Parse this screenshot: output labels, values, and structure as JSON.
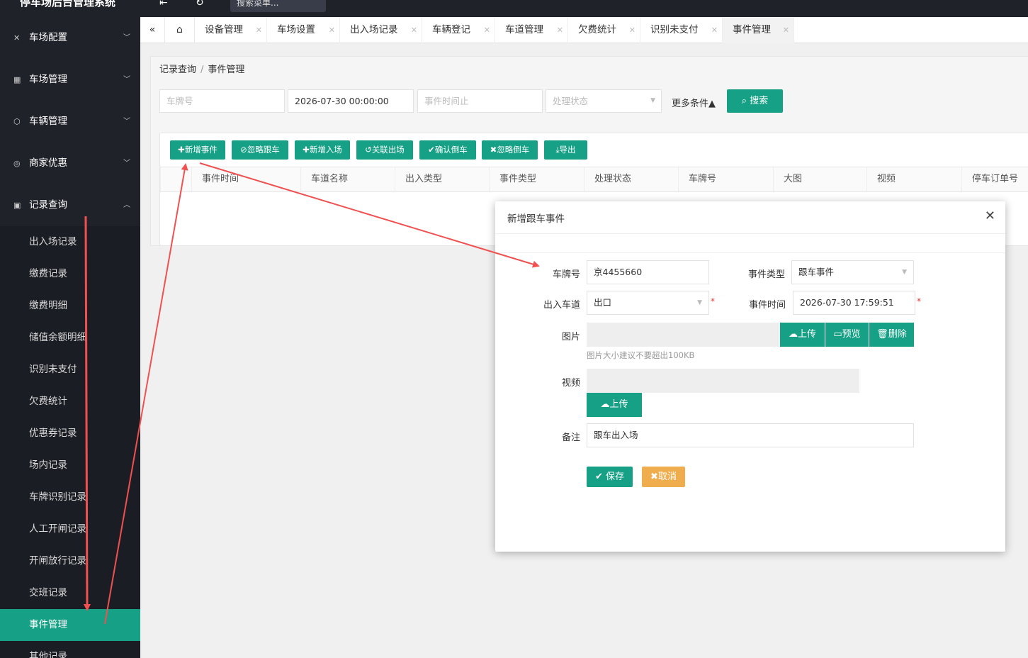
{
  "app": {
    "title": "停车场后台管理系统",
    "search_placeholder": "搜索菜单..."
  },
  "sidebar": {
    "groups": [
      {
        "label": "车场配置",
        "icon": "tools-icon"
      },
      {
        "label": "车场管理",
        "icon": "grid-icon"
      },
      {
        "label": "车辆管理",
        "icon": "cube-icon"
      },
      {
        "label": "商家优惠",
        "icon": "coin-icon"
      },
      {
        "label": "记录查询",
        "icon": "clipboard-icon",
        "expanded": true
      }
    ],
    "sub_items": [
      "出入场记录",
      "缴费记录",
      "缴费明细",
      "储值余额明细",
      "识别未支付",
      "欠费统计",
      "优惠券记录",
      "场内记录",
      "车牌识别记录",
      "人工开闸记录",
      "开闸放行记录",
      "交班记录",
      "事件管理",
      "其他记录"
    ],
    "active_sub": "事件管理"
  },
  "tabs": {
    "items": [
      "设备管理",
      "车场设置",
      "出入场记录",
      "车辆登记",
      "车道管理",
      "欠费统计",
      "识别未支付",
      "事件管理"
    ],
    "active": "事件管理"
  },
  "breadcrumb": {
    "parent": "记录查询",
    "separator": "/",
    "current": "事件管理"
  },
  "filters": {
    "plate_placeholder": "车牌号",
    "start_time": "2026-07-30 00:00:00",
    "end_placeholder": "事件时间止",
    "status_placeholder": "处理状态",
    "more_label": "更多条件",
    "search_label": "搜索"
  },
  "toolbar": [
    "新增事件",
    "忽略跟车",
    "新增入场",
    "关联出场",
    "确认倒车",
    "忽略倒车",
    "导出"
  ],
  "table": {
    "columns": [
      "事件时间",
      "车道名称",
      "出入类型",
      "事件类型",
      "处理状态",
      "车牌号",
      "大图",
      "视频",
      "停车订单号"
    ]
  },
  "modal": {
    "title": "新增跟车事件",
    "plate_label": "车牌号",
    "plate_value": "京4455660",
    "event_type_label": "事件类型",
    "event_type_value": "跟车事件",
    "lane_label": "出入车道",
    "lane_value": "出口",
    "event_time_label": "事件时间",
    "event_time_value": "2026-07-30 17:59:51",
    "required_mark": "*",
    "image_label": "图片",
    "image_upload": "上传",
    "image_preview": "预览",
    "image_delete": "删除",
    "image_hint": "图片大小建议不要超出100KB",
    "video_label": "视频",
    "video_upload": "上传",
    "remark_label": "备注",
    "remark_value": "跟车出入场",
    "save_label": "保存",
    "cancel_label": "取消"
  },
  "colors": {
    "primary": "#16a085",
    "sidebar_bg": "#20222a",
    "cancel": "#f0ad4e",
    "annotation_arrow": "#f05050"
  }
}
